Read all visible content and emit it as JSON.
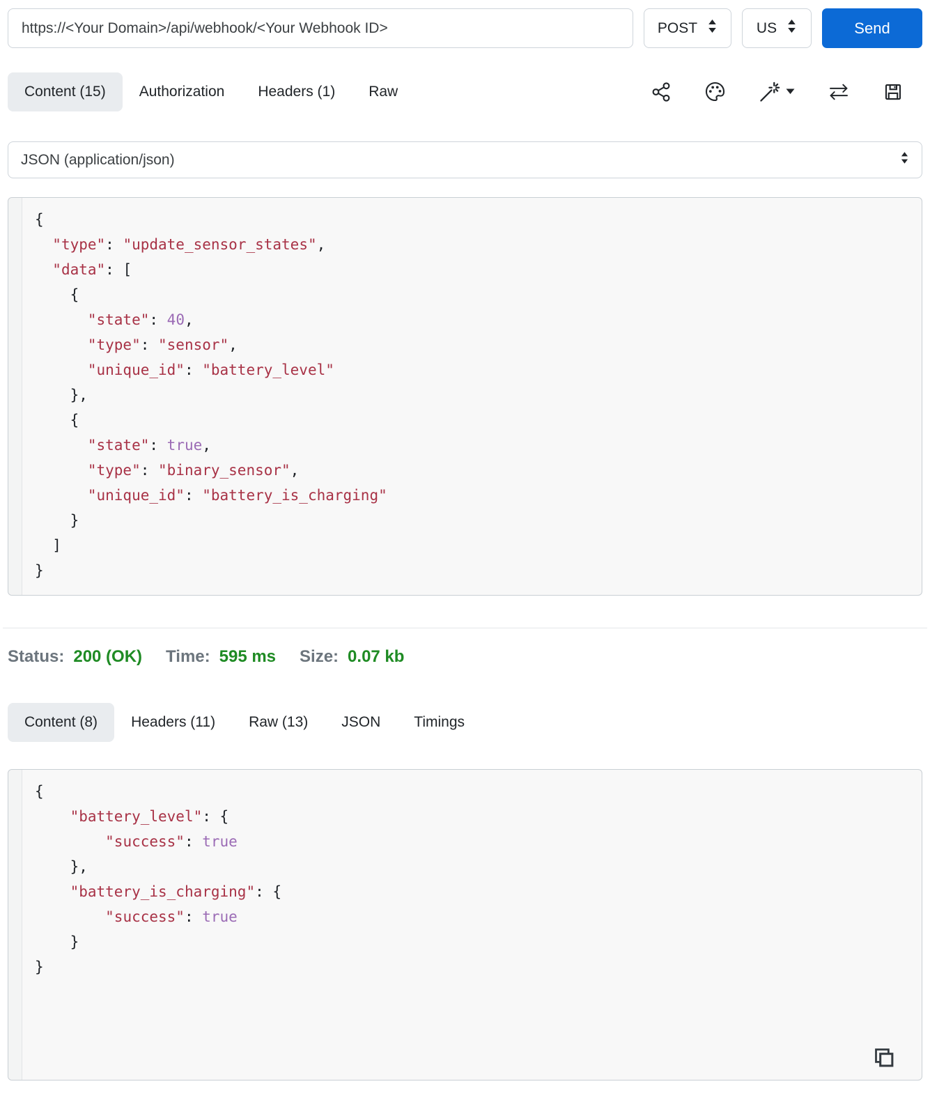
{
  "request_bar": {
    "url": "https://<Your Domain>/api/webhook/<Your Webhook ID>",
    "method": "POST",
    "environment": "US",
    "send_label": "Send"
  },
  "request": {
    "tabs": [
      {
        "label": "Content (15)",
        "name": "tab-request-content",
        "active": true
      },
      {
        "label": "Authorization",
        "name": "tab-authorization",
        "active": false
      },
      {
        "label": "Headers (1)",
        "name": "tab-request-headers",
        "active": false
      },
      {
        "label": "Raw",
        "name": "tab-request-raw",
        "active": false
      }
    ],
    "toolbar_icons": [
      "share-icon",
      "palette-icon",
      "magic-wand-icon",
      "dropdown-caret-icon",
      "swap-arrows-icon",
      "save-icon"
    ],
    "body_type": "JSON (application/json)",
    "code_lines": [
      "{",
      "  \"type\": \"update_sensor_states\",",
      "  \"data\": [",
      "    {",
      "      \"state\": 40,",
      "      \"type\": \"sensor\",",
      "      \"unique_id\": \"battery_level\"",
      "    },",
      "    {",
      "      \"state\": true,",
      "      \"type\": \"binary_sensor\",",
      "      \"unique_id\": \"battery_is_charging\"",
      "    }",
      "  ]",
      "}"
    ]
  },
  "status_bar": {
    "status_label": "Status:",
    "status_value": "200 (OK)",
    "time_label": "Time:",
    "time_value": "595 ms",
    "size_label": "Size:",
    "size_value": "0.07 kb"
  },
  "response": {
    "tabs": [
      {
        "label": "Content (8)",
        "name": "tab-response-content",
        "active": true
      },
      {
        "label": "Headers (11)",
        "name": "tab-response-headers",
        "active": false
      },
      {
        "label": "Raw (13)",
        "name": "tab-response-raw",
        "active": false
      },
      {
        "label": "JSON",
        "name": "tab-response-json",
        "active": false
      },
      {
        "label": "Timings",
        "name": "tab-response-timings",
        "active": false
      }
    ],
    "icons": [
      "copy-icon"
    ],
    "code_lines": [
      "{",
      "    \"battery_level\": {",
      "        \"success\": true",
      "    },",
      "    \"battery_is_charging\": {",
      "        \"success\": true",
      "    }",
      "}"
    ]
  },
  "colors": {
    "accent_blue": "#0c6ad6",
    "success_green": "#1f8b24",
    "label_gray": "#6c757d",
    "code_string_red": "#a83246",
    "code_literal_purple": "#9b6bb5"
  }
}
